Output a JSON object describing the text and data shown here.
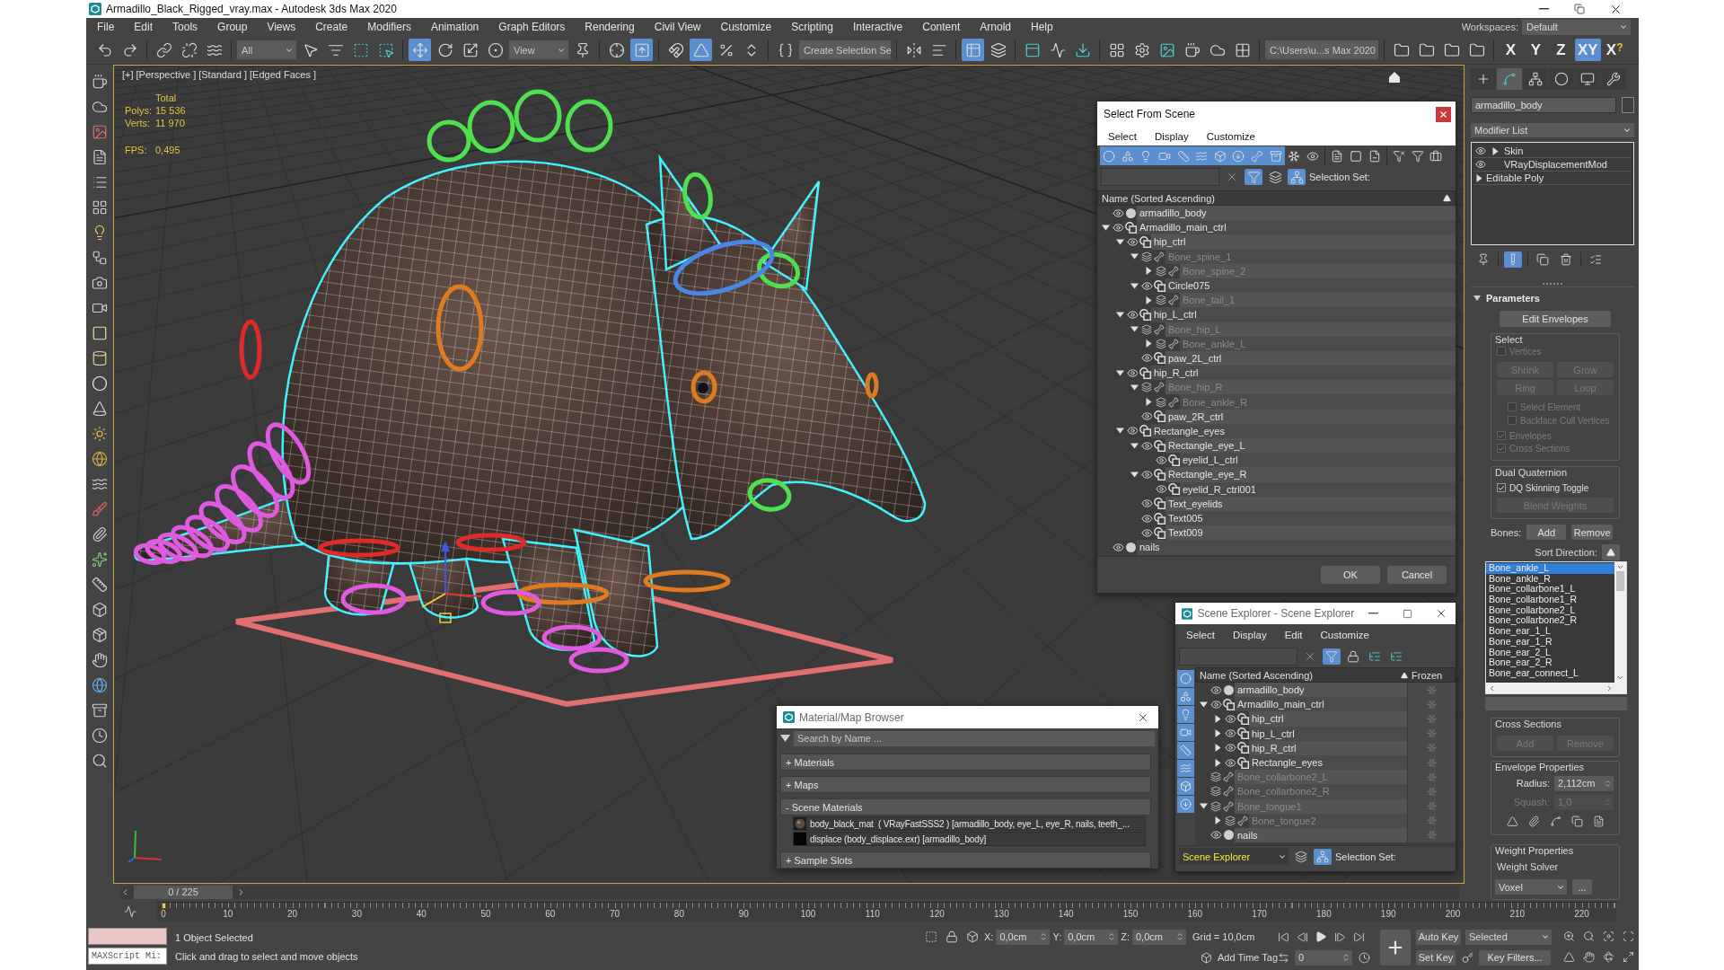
{
  "window": {
    "title": "Armadillo_Black_Rigged_vray.max - Autodesk 3ds Max 2020"
  },
  "menu": [
    "File",
    "Edit",
    "Tools",
    "Group",
    "Views",
    "Create",
    "Modifiers",
    "Animation",
    "Graph Editors",
    "Rendering",
    "Civil View",
    "Customize",
    "Scripting",
    "Interactive",
    "Content",
    "Arnold",
    "Help"
  ],
  "workspaces": {
    "label": "Workspaces:",
    "value": "Default"
  },
  "toolbar": [
    {
      "kind": "tool",
      "selected": false
    },
    {
      "kind": "tool",
      "selected": false
    },
    {
      "kind": "tool",
      "selected": false
    },
    {
      "kind": "tool",
      "selected": false
    },
    {
      "kind": "tool",
      "selected": false
    },
    {
      "kind": "dropdown",
      "value": "All"
    },
    {
      "kind": "tool",
      "selected": false
    },
    {
      "kind": "tool",
      "selected": false
    },
    {
      "kind": "tool",
      "selected": false
    },
    {
      "kind": "tool",
      "selected": false
    },
    {
      "kind": "tool",
      "selected": true
    },
    {
      "kind": "tool",
      "selected": false
    },
    {
      "kind": "tool",
      "selected": false
    },
    {
      "kind": "tool",
      "selected": false
    },
    {
      "kind": "dropdown",
      "value": "View"
    },
    {
      "kind": "tool",
      "selected": false
    },
    {
      "kind": "tool",
      "selected": false
    },
    {
      "kind": "tool",
      "selected": true
    },
    {
      "kind": "tool",
      "selected": false
    },
    {
      "kind": "tool",
      "selected": true
    },
    {
      "kind": "tool",
      "selected": false
    },
    {
      "kind": "tool",
      "selected": false
    },
    {
      "kind": "tool",
      "selected": false
    },
    {
      "kind": "dropdown",
      "value": "Create Selection Se"
    },
    {
      "kind": "tool",
      "selected": false
    },
    {
      "kind": "tool",
      "selected": false
    },
    {
      "kind": "tool",
      "selected": true
    },
    {
      "kind": "tool",
      "selected": false
    },
    {
      "kind": "tool",
      "selected": false
    },
    {
      "kind": "tool",
      "selected": false
    },
    {
      "kind": "tool",
      "selected": false
    },
    {
      "kind": "tool",
      "selected": false
    },
    {
      "kind": "tool",
      "selected": false
    },
    {
      "kind": "tool",
      "selected": false
    },
    {
      "kind": "tool",
      "selected": false
    },
    {
      "kind": "tool",
      "selected": false
    },
    {
      "kind": "tool",
      "selected": false
    },
    {
      "kind": "dropdown",
      "value": "C:\\Users\\u...s Max 2020"
    },
    {
      "kind": "tool",
      "selected": false
    },
    {
      "kind": "tool",
      "selected": false
    },
    {
      "kind": "tool",
      "selected": false
    },
    {
      "kind": "tool",
      "selected": false
    }
  ],
  "axis": [
    {
      "label": "X",
      "selected": false
    },
    {
      "label": "Y",
      "selected": false
    },
    {
      "label": "Z",
      "selected": false
    },
    {
      "label": "XY",
      "selected": true
    },
    {
      "label": "X",
      "hint": "?",
      "selected": false
    }
  ],
  "viewport": {
    "labels": [
      "[+]",
      "[Perspective ]",
      "[Standard ]",
      "[Edged Faces ]"
    ],
    "stats": {
      "header": "Total",
      "rows": [
        {
          "label": "Polys:",
          "value": "15 536"
        },
        {
          "label": "Verts:",
          "value": "11 970"
        }
      ]
    },
    "fps": {
      "label": "FPS:",
      "value": "0,495"
    }
  },
  "select_from_scene": {
    "title": "Select From Scene",
    "menu": [
      "Select",
      "Display",
      "Customize"
    ],
    "filters": [
      {
        "selected": true
      },
      {
        "selected": true
      },
      {
        "selected": true
      },
      {
        "selected": true
      },
      {
        "selected": true
      },
      {
        "selected": true
      },
      {
        "selected": true
      },
      {
        "selected": true
      },
      {
        "selected": true
      },
      {
        "selected": true
      },
      {
        "selected": false
      },
      {
        "selected": false
      },
      {
        "selected": false
      },
      {
        "selected": false
      },
      {
        "selected": false
      },
      {
        "selected": false
      },
      {
        "selected": false
      },
      {
        "selected": false
      }
    ],
    "search_tools": [
      {
        "selected": true
      },
      {
        "selected": false
      },
      {
        "selected": true
      }
    ],
    "selection_set": "Selection Set:",
    "column": "Name (Sorted Ascending)",
    "tree": [
      {
        "name": "armadillo_body",
        "kind": "geometry"
      },
      {
        "name": "Armadillo_main_ctrl",
        "kind": "shape",
        "expanded": true,
        "children": [
          {
            "name": "hip_ctrl",
            "kind": "shape",
            "expanded": true,
            "children": [
              {
                "name": "Bone_spine_1",
                "kind": "bone",
                "expanded": true,
                "children": [
                  {
                    "name": "Bone_spine_2",
                    "kind": "bone",
                    "expanded": false
                  }
                ]
              },
              {
                "name": "Circle075",
                "kind": "shape",
                "expanded": true,
                "children": [
                  {
                    "name": "Bone_tail_1",
                    "kind": "bone",
                    "expanded": false
                  }
                ]
              }
            ]
          },
          {
            "name": "hip_L_ctrl",
            "kind": "shape",
            "expanded": true,
            "children": [
              {
                "name": "Bone_hip_L",
                "kind": "bone",
                "expanded": true,
                "children": [
                  {
                    "name": "Bone_ankle_L",
                    "kind": "bone",
                    "expanded": false
                  }
                ]
              },
              {
                "name": "paw_2L_ctrl",
                "kind": "shape"
              }
            ]
          },
          {
            "name": "hip_R_ctrl",
            "kind": "shape",
            "expanded": true,
            "children": [
              {
                "name": "Bone_hip_R",
                "kind": "bone",
                "expanded": true,
                "children": [
                  {
                    "name": "Bone_ankle_R",
                    "kind": "bone",
                    "expanded": false
                  }
                ]
              },
              {
                "name": "paw_2R_ctrl",
                "kind": "shape"
              }
            ]
          },
          {
            "name": "Rectangle_eyes",
            "kind": "shape",
            "expanded": true,
            "children": [
              {
                "name": "Rectangle_eye_L",
                "kind": "shape",
                "expanded": true,
                "children": [
                  {
                    "name": "eyelid_L_ctrl",
                    "kind": "shape"
                  }
                ]
              },
              {
                "name": "Rectangle_eye_R",
                "kind": "shape",
                "expanded": true,
                "children": [
                  {
                    "name": "eyelid_R_ctrl001",
                    "kind": "shape"
                  }
                ]
              },
              {
                "name": "Text_eyelids",
                "kind": "shape"
              },
              {
                "name": "Text005",
                "kind": "shape"
              },
              {
                "name": "Text009",
                "kind": "shape"
              }
            ]
          }
        ]
      },
      {
        "name": "nails",
        "kind": "geometry"
      }
    ],
    "buttons": [
      "OK",
      "Cancel"
    ]
  },
  "scene_explorer": {
    "title": "Scene Explorer - Scene Explorer",
    "menu": [
      "Select",
      "Display",
      "Edit",
      "Customize"
    ],
    "filters": [
      {
        "selected": true
      },
      {
        "selected": true
      },
      {
        "selected": true
      },
      {
        "selected": true
      },
      {
        "selected": true
      },
      {
        "selected": true
      },
      {
        "selected": true
      },
      {
        "selected": true
      }
    ],
    "search_tools": [
      {
        "selected": true
      },
      {
        "selected": false
      },
      {
        "selected": false
      },
      {
        "selected": false
      }
    ],
    "columns": [
      "Name (Sorted Ascending)",
      "Frozen"
    ],
    "tree": [
      {
        "name": "armadillo_body",
        "kind": "geometry",
        "frozen": false
      },
      {
        "name": "Armadillo_main_ctrl",
        "kind": "shape",
        "frozen": false,
        "expanded": true,
        "children": [
          {
            "name": "hip_ctrl",
            "kind": "shape",
            "frozen": false,
            "expanded": false
          },
          {
            "name": "hip_L_ctrl",
            "kind": "shape",
            "frozen": false,
            "expanded": false
          },
          {
            "name": "hip_R_ctrl",
            "kind": "shape",
            "frozen": false,
            "expanded": false
          },
          {
            "name": "Rectangle_eyes",
            "kind": "shape",
            "frozen": false,
            "expanded": false
          }
        ]
      },
      {
        "name": "Bone_collarbone2_L",
        "kind": "bone",
        "frozen": false
      },
      {
        "name": "Bone_collarbone2_R",
        "kind": "bone",
        "frozen": false
      },
      {
        "name": "Bone_tongue1",
        "kind": "bone",
        "frozen": false,
        "expanded": true,
        "children": [
          {
            "name": "Bone_tongue2",
            "kind": "bone",
            "frozen": false,
            "expanded": false
          }
        ]
      },
      {
        "name": "nails",
        "kind": "geometry",
        "frozen": false
      }
    ],
    "explorer": "Scene Explorer",
    "bottom_tools": [
      {
        "selected": false
      },
      {
        "selected": true
      }
    ],
    "selection_set": "Selection Set:"
  },
  "material_browser": {
    "title": "Material/Map Browser",
    "search": {
      "placeholder": "Search by Name ..."
    },
    "sections": [
      {
        "label": "+ Materials"
      },
      {
        "label": "+ Maps"
      },
      {
        "label": "- Scene Materials",
        "items": [
          {
            "kind": "material",
            "label": "body_black_mat  ( VRayFastSSS2 ) [armadillo_body, eye_L, eye_R, nails, teeth_..."
          },
          {
            "kind": "map",
            "label": "displace (body_displace.exr) [armadillo_body]"
          }
        ]
      },
      {
        "label": "+ Sample Slots"
      }
    ]
  },
  "command_panel": {
    "tabs": [
      {
        "selected": false
      },
      {
        "selected": true
      },
      {
        "selected": false
      },
      {
        "selected": false
      },
      {
        "selected": false
      },
      {
        "selected": false
      }
    ],
    "object_name": "armadillo_body",
    "modifier_list": "Modifier List",
    "stack": [
      {
        "name": "Skin",
        "kind": "modifier",
        "enabled": true,
        "expandable": true
      },
      {
        "name": "VRayDisplacementMod",
        "kind": "modifier",
        "enabled": true,
        "expandable": false
      },
      {
        "name": "Editable Poly",
        "kind": "base",
        "expandable": true
      }
    ],
    "stack_tools": [
      {
        "selected": false
      },
      {
        "selected": true
      },
      {
        "selected": false
      },
      {
        "selected": false
      },
      {
        "selected": false
      }
    ],
    "rollout": {
      "title": "Parameters",
      "expanded": true
    },
    "edit_envelopes": "Edit Envelopes",
    "select_group": {
      "title": "Select",
      "disabled": true,
      "vertices": {
        "label": "Vertices",
        "checked": false
      },
      "buttons": [
        "Shrink",
        "Grow",
        "Ring",
        "Loop"
      ],
      "options": [
        {
          "label": "Select Element",
          "checked": false
        },
        {
          "label": "Backface Cull Vertices",
          "checked": false
        }
      ],
      "display": [
        {
          "label": "Envelopes",
          "checked": true
        },
        {
          "label": "Cross Sections",
          "checked": true
        }
      ]
    },
    "dual_quaternion": {
      "title": "Dual Quaternion",
      "toggle": {
        "label": "DQ Skinning Toggle",
        "checked": true
      },
      "button": {
        "label": "Blend Weights",
        "disabled": true
      }
    },
    "bones": {
      "label": "Bones:",
      "buttons": [
        "Add",
        "Remove"
      ],
      "sort_label": "Sort Direction:",
      "list": [
        {
          "name": "Bone_ankle_L",
          "selected": true
        },
        {
          "name": "Bone_ankle_R",
          "selected": false
        },
        {
          "name": "Bone_collarbone1_L",
          "selected": false
        },
        {
          "name": "Bone_collarbone1_R",
          "selected": false
        },
        {
          "name": "Bone_collarbone2_L",
          "selected": false
        },
        {
          "name": "Bone_collarbone2_R",
          "selected": false
        },
        {
          "name": "Bone_ear_1_L",
          "selected": false
        },
        {
          "name": "Bone_ear_1_R",
          "selected": false
        },
        {
          "name": "Bone_ear_2_L",
          "selected": false
        },
        {
          "name": "Bone_ear_2_R",
          "selected": false
        },
        {
          "name": "Bone_ear_connect_L",
          "selected": false
        }
      ]
    },
    "cross_sections": {
      "title": "Cross Sections",
      "buttons": [
        "Add",
        "Remove"
      ],
      "disabled": true
    },
    "envelope_properties": {
      "title": "Envelope Properties",
      "fields": [
        {
          "label": "Radius:",
          "value": "2,112cm",
          "disabled": false
        },
        {
          "label": "Squash:",
          "value": "1,0",
          "disabled": true
        }
      ]
    },
    "weight_properties": {
      "title": "Weight Properties",
      "solver_label": "Weight Solver",
      "solver": "Voxel",
      "more": "..."
    }
  },
  "time_slider": {
    "label": "0 / 225"
  },
  "track_bar": {
    "ticks": [
      "0",
      "10",
      "20",
      "30",
      "40",
      "50",
      "60",
      "70",
      "80",
      "90",
      "100",
      "110",
      "120",
      "130",
      "140",
      "150",
      "160",
      "170",
      "180",
      "190",
      "200",
      "210",
      "220"
    ]
  },
  "status": {
    "maxscript": "MAXScript Mi:",
    "selection": "1 Object Selected",
    "prompt": "Click and drag to select and move objects",
    "coords": [
      {
        "label": "X:",
        "value": "0,0cm"
      },
      {
        "label": "Y:",
        "value": "0,0cm"
      },
      {
        "label": "Z:",
        "value": "0,0cm"
      }
    ],
    "grid": "Grid = 10,0cm",
    "time_tag": "Add Time Tag",
    "frame": "0",
    "auto_key": {
      "label": "Auto Key",
      "on": false
    },
    "key_set": "Selected",
    "set_key": "Set Key",
    "key_filters": "Key Filters..."
  }
}
